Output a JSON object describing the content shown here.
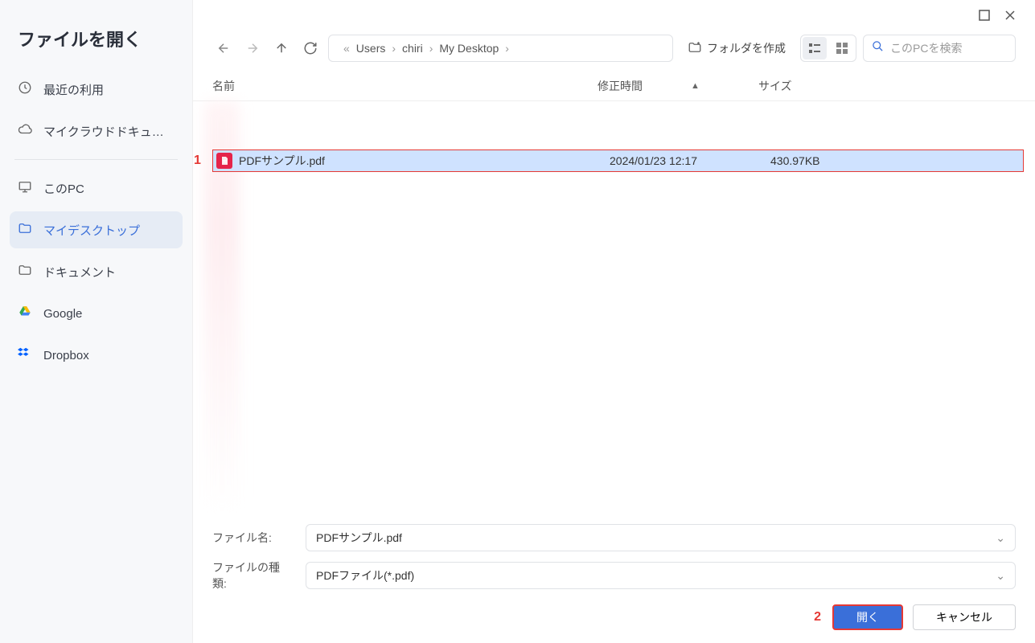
{
  "sidebar": {
    "title": "ファイルを開く",
    "items": [
      {
        "label": "最近の利用"
      },
      {
        "label": "マイクラウドドキュ…"
      },
      {
        "label": "このPC"
      },
      {
        "label": "マイデスクトップ"
      },
      {
        "label": "ドキュメント"
      },
      {
        "label": "Google"
      },
      {
        "label": "Dropbox"
      }
    ]
  },
  "breadcrumb": {
    "ellipsis_left": "«",
    "parts": [
      "Users",
      "chiri",
      "My Desktop"
    ]
  },
  "toolbar": {
    "create_folder_label": "フォルダを作成"
  },
  "search": {
    "placeholder": "このPCを検索"
  },
  "columns": {
    "name": "名前",
    "date": "修正時間",
    "size": "サイズ",
    "sort_arrow": "▲"
  },
  "files": [
    {
      "annot": "1",
      "name": "PDFサンプル.pdf",
      "date": "2024/01/23 12:17",
      "size": "430.97KB"
    }
  ],
  "form": {
    "filename_label": "ファイル名:",
    "filename_value": "PDFサンプル.pdf",
    "filetype_label": "ファイルの種類:",
    "filetype_value": "PDFファイル(*.pdf)"
  },
  "actions": {
    "annot2": "2",
    "open": "開く",
    "cancel": "キャンセル"
  }
}
